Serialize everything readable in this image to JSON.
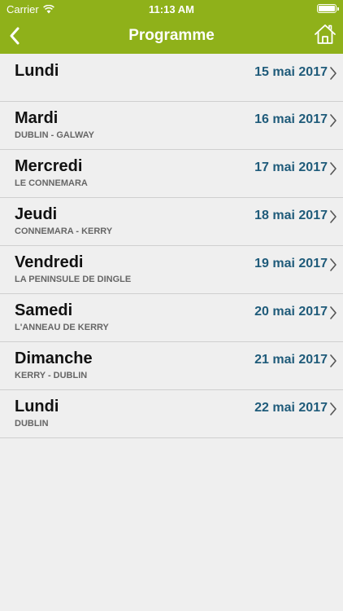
{
  "status_bar": {
    "carrier": "Carrier",
    "time": "11:13 AM",
    "battery_level": 1.0
  },
  "nav": {
    "title": "Programme",
    "back_icon": "chevron-left-icon",
    "home_icon": "home-icon"
  },
  "colors": {
    "header_bg": "#8fb11a",
    "date_text": "#1f5b7a",
    "background": "#efefef"
  },
  "days": [
    {
      "day": "Lundi",
      "subtitle": "",
      "date": "15 mai 2017"
    },
    {
      "day": "Mardi",
      "subtitle": "DUBLIN - GALWAY",
      "date": "16 mai 2017"
    },
    {
      "day": "Mercredi",
      "subtitle": "LE CONNEMARA",
      "date": "17 mai 2017"
    },
    {
      "day": "Jeudi",
      "subtitle": "CONNEMARA - KERRY",
      "date": "18 mai 2017"
    },
    {
      "day": "Vendredi",
      "subtitle": "LA PENINSULE DE DINGLE",
      "date": "19 mai 2017"
    },
    {
      "day": "Samedi",
      "subtitle": "L'ANNEAU DE KERRY",
      "date": "20 mai 2017"
    },
    {
      "day": "Dimanche",
      "subtitle": "KERRY - DUBLIN",
      "date": "21 mai 2017"
    },
    {
      "day": "Lundi",
      "subtitle": "DUBLIN",
      "date": "22 mai 2017"
    }
  ]
}
